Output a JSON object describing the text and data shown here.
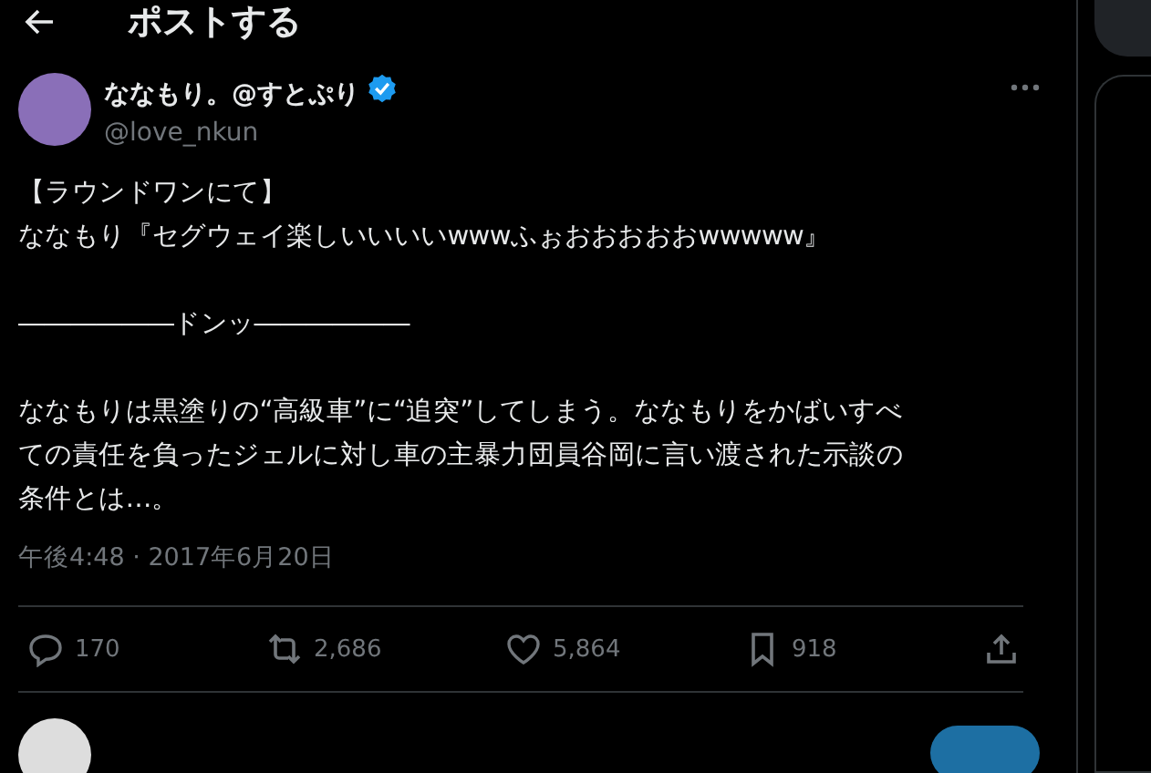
{
  "header": {
    "title": "ポストする"
  },
  "post": {
    "author": {
      "name": "ななもり。@すとぷり",
      "verified": true,
      "handle": "@love_nkun"
    },
    "paragraphs": [
      [
        "【ラウンドワンにて】",
        "ななもり『セグウェイ楽しいいいいwwwふぉおおおおおwwwww』"
      ],
      [
        "――――――ドンッ――――――"
      ],
      [
        "ななもりは黒塗りの“高級車”に“追突”してしまう。ななもりをかばいすべ",
        "ての責任を負ったジェルに対し車の主暴力団員谷岡に言い渡された示談の",
        "条件とは…。"
      ]
    ],
    "timestamp": "午後4:48 · 2017年6月20日",
    "actions": [
      {
        "kind": "reply",
        "count": "170"
      },
      {
        "kind": "repost",
        "count": "2,686"
      },
      {
        "kind": "like",
        "count": "5,864"
      },
      {
        "kind": "bookmark",
        "count": "918"
      },
      {
        "kind": "share"
      }
    ]
  }
}
